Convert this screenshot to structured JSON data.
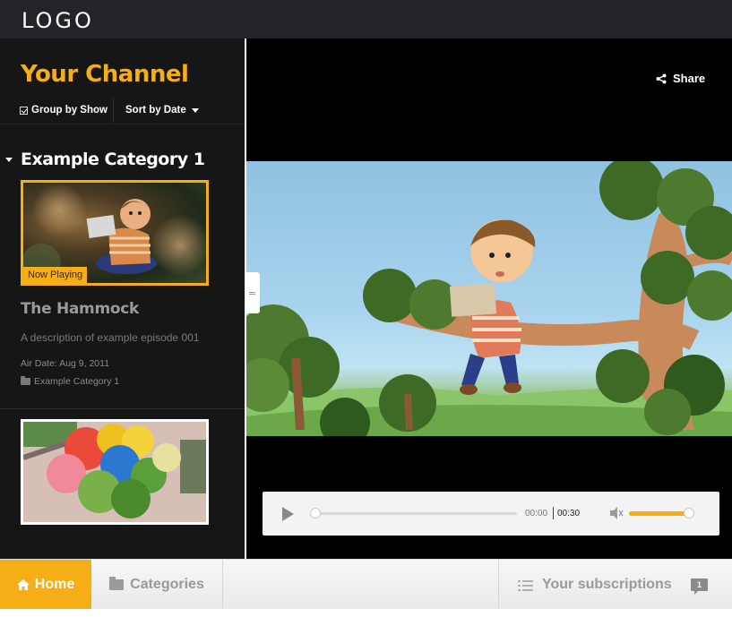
{
  "header": {
    "logo": "LOGO"
  },
  "sidebar": {
    "channel_title": "Your Channel",
    "group_by_label": "Group by Show",
    "sort_label": "Sort by Date",
    "category": {
      "title": "Example Category 1"
    },
    "episodes": [
      {
        "badge": "Now Playing",
        "title": "The Hammock",
        "description": "A description of example episode 001",
        "air_date": "Air Date: Aug 9, 2011",
        "category": "Example Category 1"
      }
    ]
  },
  "player": {
    "share_label": "Share",
    "current_time": "00:00",
    "total_time": "00:30",
    "progress_fraction": 0.0,
    "volume_fraction": 0.95
  },
  "bottom_nav": {
    "home_label": "Home",
    "categories_label": "Categories",
    "subscriptions_label": "Your subscriptions",
    "subscriptions_count": "1"
  },
  "colors": {
    "accent": "#f5ae15",
    "topbar": "#242428",
    "sidebar": "#161616"
  }
}
